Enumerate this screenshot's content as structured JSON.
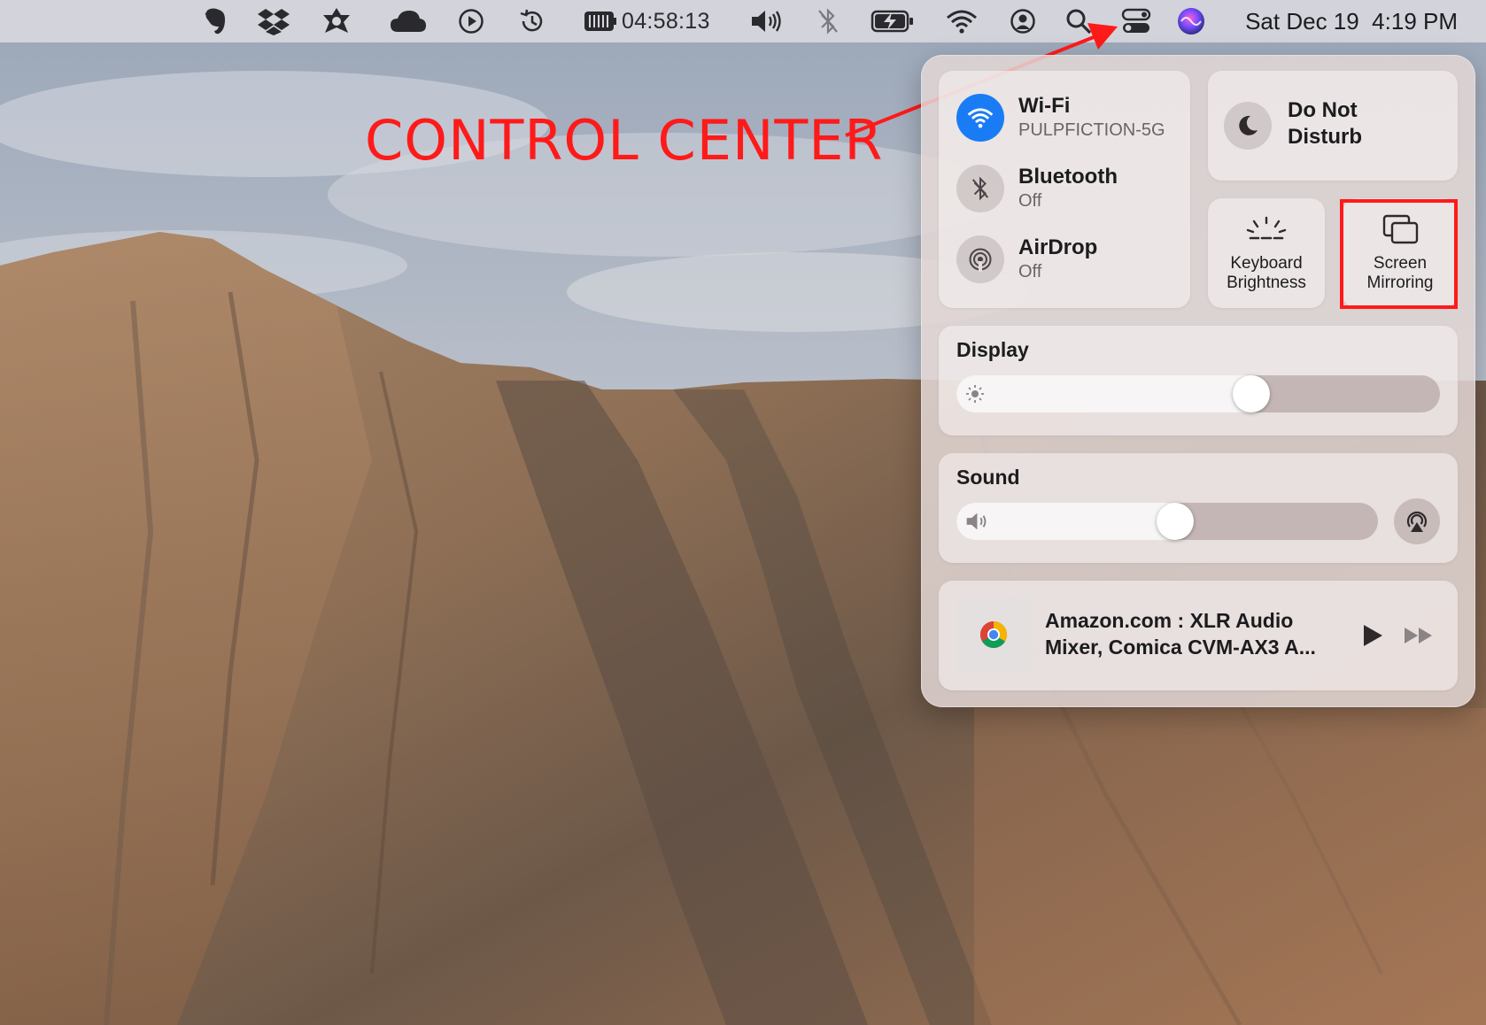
{
  "menubar": {
    "icons": [
      "evernote-icon",
      "dropbox-icon",
      "alfred-icon",
      "creative-cloud-icon",
      "play-circle-icon",
      "time-machine-icon",
      "battery-meter-icon",
      "volume-icon",
      "bluetooth-off-icon",
      "battery-charging-icon",
      "wifi-icon",
      "user-account-icon",
      "spotlight-search-icon",
      "control-center-icon",
      "siri-icon"
    ],
    "battery_timer": "04:58:13",
    "clock": "Sat Dec 19  4:19 PM"
  },
  "annotation": {
    "label": "CONTROL CENTER",
    "color": "#ff1a1a"
  },
  "control_center": {
    "wifi": {
      "title": "Wi-Fi",
      "subtitle": "PULPFICTION-5G",
      "state": "on"
    },
    "bluetooth": {
      "title": "Bluetooth",
      "subtitle": "Off",
      "state": "off"
    },
    "airdrop": {
      "title": "AirDrop",
      "subtitle": "Off",
      "state": "off"
    },
    "do_not_disturb": {
      "line1": "Do Not",
      "line2": "Disturb"
    },
    "keyboard_brightness": {
      "line1": "Keyboard",
      "line2": "Brightness"
    },
    "screen_mirroring": {
      "line1": "Screen",
      "line2": "Mirroring"
    },
    "display": {
      "title": "Display",
      "level": 0.62
    },
    "sound": {
      "title": "Sound",
      "level": 0.52
    },
    "now_playing": {
      "line1": "Amazon.com : XLR Audio",
      "line2": "Mixer, Comica CVM-AX3 A...",
      "source_icon": "chrome-icon"
    },
    "accent_color": "#1a7cf5"
  }
}
